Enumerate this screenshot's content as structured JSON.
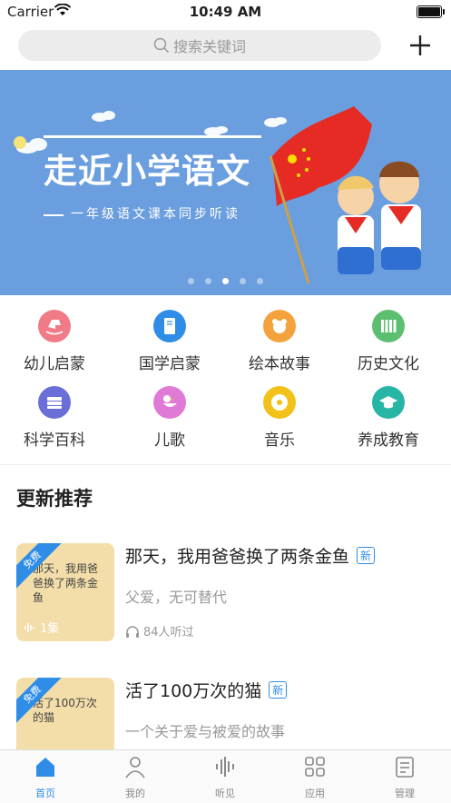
{
  "status": {
    "carrier": "Carrier",
    "time": "10:49 AM"
  },
  "search": {
    "placeholder": "搜索关键词"
  },
  "banner": {
    "title": "走近小学语文",
    "subtitle": "一年级语文课本同步听读",
    "slides": 5,
    "active_slide": 3
  },
  "categories": [
    {
      "label": "幼儿启蒙",
      "icon": "rocking-horse-icon",
      "color": "#f07b86"
    },
    {
      "label": "国学启蒙",
      "icon": "book-icon",
      "color": "#2f8de8"
    },
    {
      "label": "绘本故事",
      "icon": "bear-icon",
      "color": "#f3a23c"
    },
    {
      "label": "历史文化",
      "icon": "bamboo-scroll-icon",
      "color": "#5cbf6f"
    },
    {
      "label": "科学百科",
      "icon": "books-stack-icon",
      "color": "#6a6fd8"
    },
    {
      "label": "儿歌",
      "icon": "duck-icon",
      "color": "#e07ad7"
    },
    {
      "label": "音乐",
      "icon": "record-icon",
      "color": "#f2c21b"
    },
    {
      "label": "养成教育",
      "icon": "graduation-cap-icon",
      "color": "#27b5a5"
    }
  ],
  "section": {
    "title": "更新推荐"
  },
  "items": [
    {
      "title": "那天，我用爸爸换了两条金鱼",
      "badge": "新",
      "desc": "父爱，无可替代",
      "plays": "84人听过",
      "ribbon": "免费",
      "episodes": "1集",
      "thumb_text": "那天，我用爸爸换了两条金鱼"
    },
    {
      "title": "活了100万次的猫",
      "badge": "新",
      "desc": "一个关于爱与被爱的故事",
      "plays": "",
      "ribbon": "免费",
      "episodes": "",
      "thumb_text": "活了100万次的猫"
    }
  ],
  "tabs": [
    {
      "label": "首页",
      "icon": "home-icon",
      "active": true
    },
    {
      "label": "我的",
      "icon": "person-icon",
      "active": false
    },
    {
      "label": "听见",
      "icon": "soundwave-icon",
      "active": false
    },
    {
      "label": "应用",
      "icon": "apps-icon",
      "active": false
    },
    {
      "label": "管理",
      "icon": "manage-icon",
      "active": false
    }
  ],
  "colors": {
    "accent": "#2f8de8",
    "banner_bg": "#6b9ede"
  }
}
